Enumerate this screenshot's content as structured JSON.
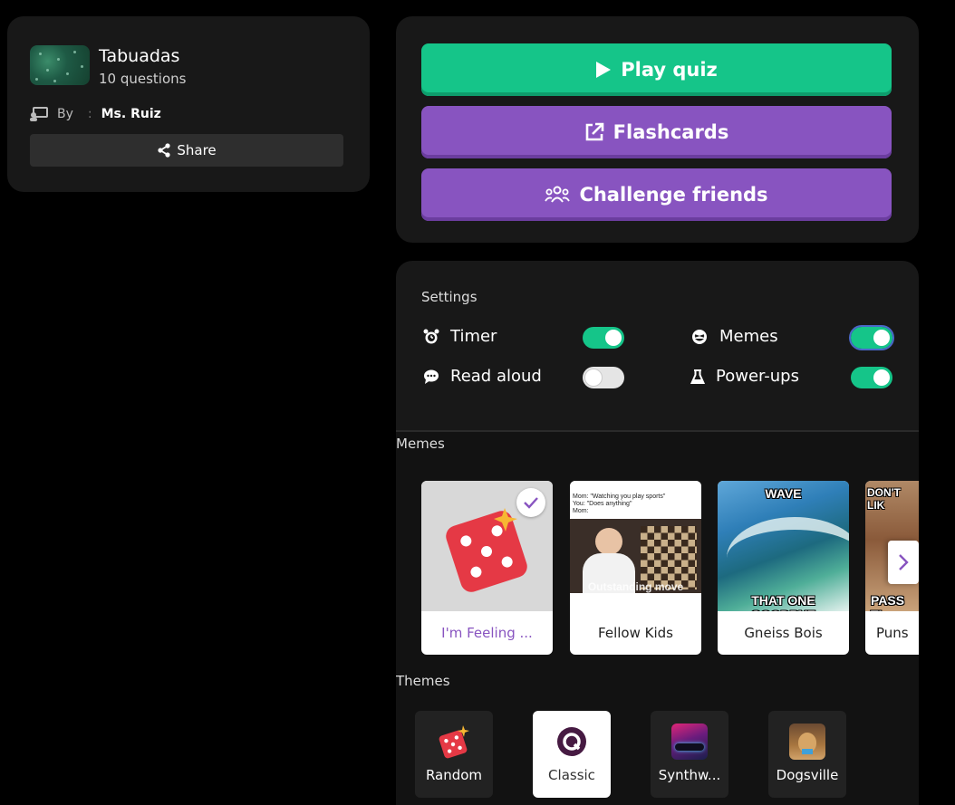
{
  "quiz": {
    "title": "Tabuadas",
    "questions": "10 questions",
    "by_label": "By",
    "separator": ":",
    "author": "Ms. Ruiz",
    "share_label": "Share"
  },
  "actions": {
    "play": "Play quiz",
    "flashcards": "Flashcards",
    "challenge": "Challenge friends"
  },
  "settings": {
    "title": "Settings",
    "items": [
      {
        "label": "Timer",
        "enabled": true
      },
      {
        "label": "Memes",
        "enabled": true
      },
      {
        "label": "Read aloud",
        "enabled": false
      },
      {
        "label": "Power-ups",
        "enabled": true
      }
    ]
  },
  "memes": {
    "title": "Memes",
    "cards": [
      {
        "label": "I'm Feeling ...",
        "selected": true
      },
      {
        "label": "Fellow Kids",
        "selected": false,
        "caption_top": "Mom: \"Watching you play sports\"",
        "caption_2": "You: \"Does anything\"",
        "caption_3": "Mom:",
        "caption_bottom": "Outstanding move"
      },
      {
        "label": "Gneiss Bois",
        "selected": false,
        "caption_top": "WAVE",
        "caption_bottom": "THAT ONE GOODBYE"
      },
      {
        "label": "Puns",
        "selected": false,
        "caption_top": "DON'T LIK",
        "caption_bottom": "PASS TI"
      }
    ]
  },
  "themes": {
    "title": "Themes",
    "items": [
      {
        "label": "Random",
        "active": false
      },
      {
        "label": "Classic",
        "active": true
      },
      {
        "label": "Synthw...",
        "active": false
      },
      {
        "label": "Dogsville",
        "active": false
      }
    ]
  },
  "colors": {
    "green": "#15c589",
    "purple": "#8854c0",
    "card_bg": "#181818"
  }
}
